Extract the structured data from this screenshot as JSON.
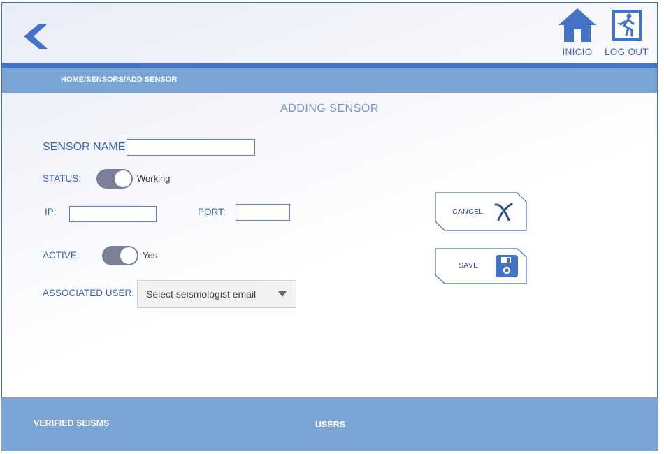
{
  "header": {
    "back_icon": "chevron-left-icon",
    "home_label": "INICIO",
    "home_icon": "house-icon",
    "logout_label": "LOG OUT",
    "logout_icon": "exit-door-icon"
  },
  "breadcrumb": "HOME/SENSORS/ADD SENSOR",
  "form": {
    "title": "ADDING  SENSOR",
    "sensor_name_label": "SENSOR NAME",
    "sensor_name_value": "",
    "status_label": "STATUS:",
    "status_value": "Working",
    "status_on": true,
    "ip_label": "IP:",
    "ip_value": "",
    "port_label": "PORT:",
    "port_value": "",
    "active_label": "ACTIVE:",
    "active_value": "Yes",
    "active_on": true,
    "user_label": "ASSOCIATED USER:",
    "user_placeholder": "Select seismologist email"
  },
  "actions": {
    "cancel_label": "CANCEL",
    "cancel_icon": "x-icon",
    "save_label": "SAVE",
    "save_icon": "floppy-disk-icon"
  },
  "footer": {
    "verified_label": "VERIFIED SEISMS",
    "users_label": "USERS"
  },
  "colors": {
    "accent": "#4472c4",
    "bar": "#7aa4d4",
    "toggle": "#7a8196"
  }
}
